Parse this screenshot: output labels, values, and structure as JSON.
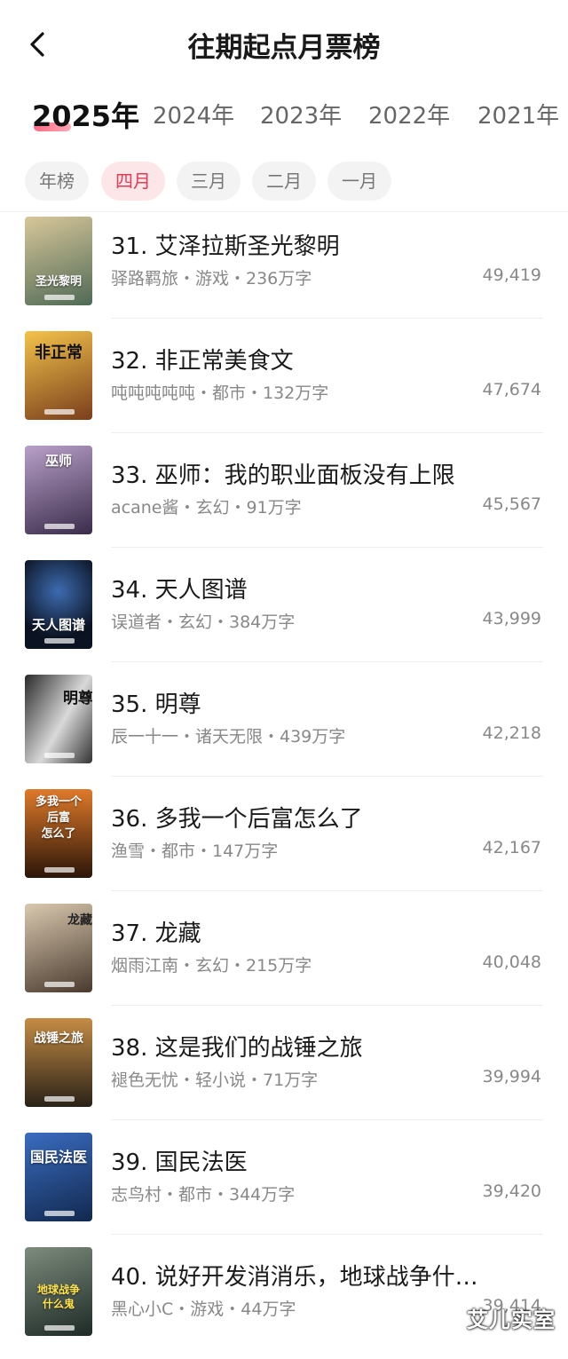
{
  "header": {
    "title": "往期起点月票榜"
  },
  "year_tabs": [
    "2025年",
    "2024年",
    "2023年",
    "2022年",
    "2021年"
  ],
  "month_tabs": [
    "年榜",
    "四月",
    "三月",
    "二月",
    "一月"
  ],
  "books": [
    {
      "rank_title": "31. 艾泽拉斯圣光黎明",
      "meta": "驿路羁旅・游戏・236万字",
      "votes": "49,419",
      "cover_text": "圣光黎明",
      "cover_colors": [
        "#c9b98c",
        "#5b7a5a"
      ]
    },
    {
      "rank_title": "32. 非正常美食文",
      "meta": "吨吨吨吨吨・都市・132万字",
      "votes": "47,674",
      "cover_text": "非正常",
      "cover_colors": [
        "#f0b63a",
        "#7a3e1c"
      ]
    },
    {
      "rank_title": "33. 巫师：我的职业面板没有上限",
      "meta": "acane酱・玄幻・91万字",
      "votes": "45,567",
      "cover_text": "巫师",
      "cover_colors": [
        "#a58ab8",
        "#3f3050"
      ]
    },
    {
      "rank_title": "34. 天人图谱",
      "meta": "误道者・玄幻・384万字",
      "votes": "43,999",
      "cover_text": "天人图谱",
      "cover_colors": [
        "#2a4a7a",
        "#0c1424"
      ]
    },
    {
      "rank_title": "35. 明尊",
      "meta": "辰一十一・诸天无限・439万字",
      "votes": "42,218",
      "cover_text": "明尊",
      "cover_colors": [
        "#e8e8e8",
        "#222222"
      ]
    },
    {
      "rank_title": "36. 多我一个后富怎么了",
      "meta": "渔雪・都市・147万字",
      "votes": "42,167",
      "cover_text": "多我一个后富怎么了",
      "cover_colors": [
        "#d2691e",
        "#2b1608"
      ]
    },
    {
      "rank_title": "37. 龙藏",
      "meta": "烟雨江南・玄幻・215万字",
      "votes": "40,048",
      "cover_text": "龙藏",
      "cover_colors": [
        "#c9b79f",
        "#5a4a3a"
      ]
    },
    {
      "rank_title": "38. 这是我们的战锤之旅",
      "meta": "褪色无忧・轻小说・71万字",
      "votes": "39,994",
      "cover_text": "战锤之旅",
      "cover_colors": [
        "#b07a3a",
        "#2a2218"
      ]
    },
    {
      "rank_title": "39. 国民法医",
      "meta": "志鸟村・都市・344万字",
      "votes": "39,420",
      "cover_text": "国民法医",
      "cover_colors": [
        "#2f5ca8",
        "#11294f"
      ]
    },
    {
      "rank_title": "40. 说好开发消消乐，地球战争什…",
      "meta": "黑心小C・游戏・44万字",
      "votes": "39,414",
      "cover_text": "地球战争什么鬼",
      "cover_colors": [
        "#6a7a6a",
        "#1e2a26"
      ]
    }
  ],
  "watermark": "艾儿实室"
}
